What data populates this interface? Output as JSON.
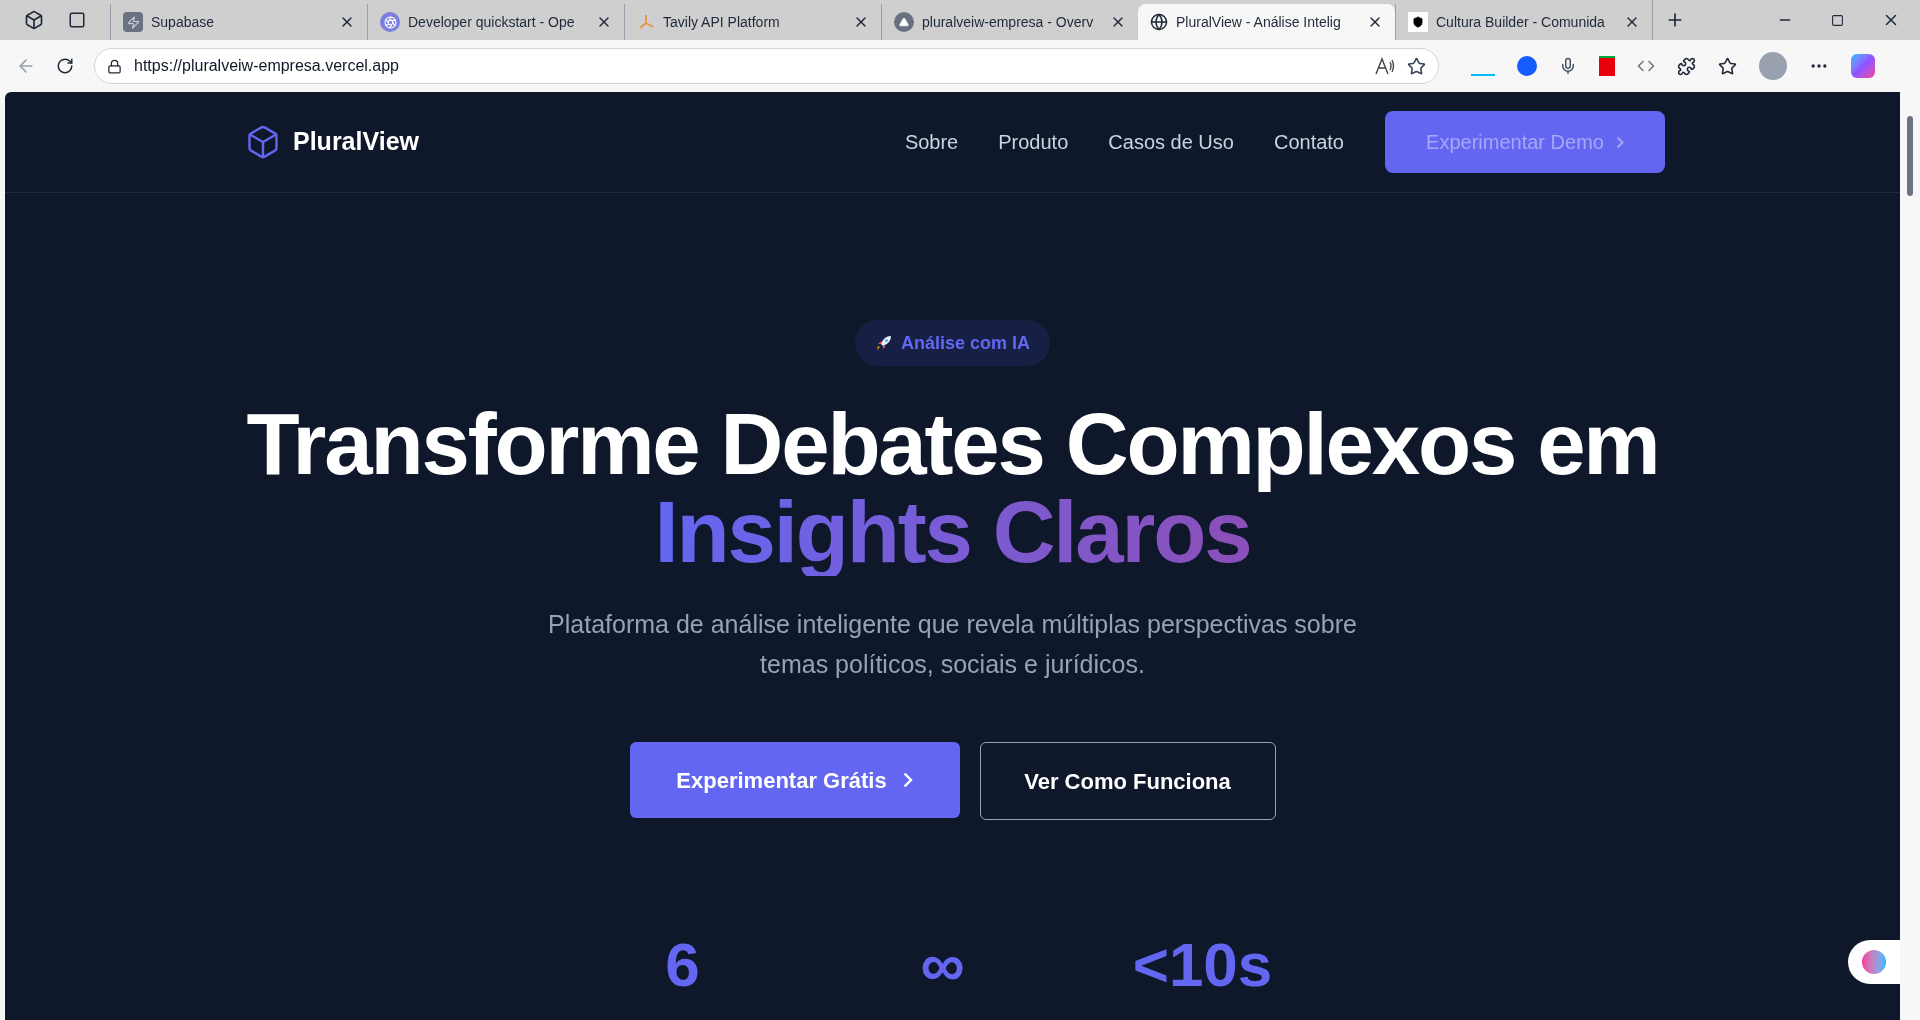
{
  "browser": {
    "tabs": [
      {
        "title": "Supabase",
        "selected": false
      },
      {
        "title": "Developer quickstart - Ope",
        "selected": false
      },
      {
        "title": "Tavily API Platform",
        "selected": false
      },
      {
        "title": "pluralveiw-empresa - Overv",
        "selected": false
      },
      {
        "title": "PluralView - Análise Intelig",
        "selected": true
      },
      {
        "title": "Cultura Builder - Comunida",
        "selected": false
      }
    ],
    "url": "https://pluralveiw-empresa.vercel.app"
  },
  "nav": {
    "brand": "PluralView",
    "links": [
      "Sobre",
      "Produto",
      "Casos de Uso",
      "Contato"
    ],
    "cta": "Experimentar Demo"
  },
  "hero": {
    "badge": "Análise com IA",
    "title": "Transforme Debates Complexos em",
    "highlight": "Insights Claros",
    "subtitle": "Plataforma de análise inteligente que revela múltiplas perspectivas sobre temas políticos, sociais e jurídicos.",
    "primary": "Experimentar Grátis",
    "secondary": "Ver Como Funciona"
  },
  "stats": [
    "6",
    "∞",
    "<10s"
  ]
}
